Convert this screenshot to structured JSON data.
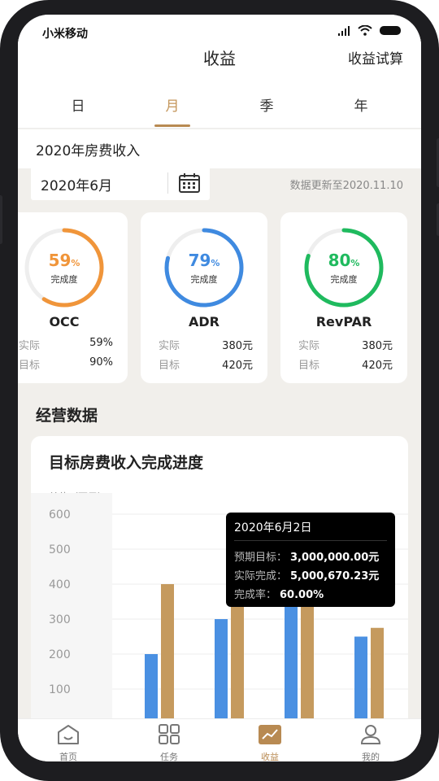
{
  "status_bar": {
    "carrier": "小米移动"
  },
  "header": {
    "title": "收益",
    "trial_link": "收益试算"
  },
  "tabs": [
    {
      "label": "日"
    },
    {
      "label": "月",
      "active": true
    },
    {
      "label": "季"
    },
    {
      "label": "年"
    }
  ],
  "section": {
    "title": "2020年房费收入"
  },
  "date_picker": {
    "value": "2020年6月"
  },
  "update_note": "数据更新至2020.11.10",
  "kpi_cards": [
    {
      "name": "OCC",
      "percent": "59",
      "percent_value": 59,
      "percent_unit": "%",
      "progress_label": "完成度",
      "color": "#f0953a",
      "rows": [
        {
          "key": "实际",
          "value": "59%"
        },
        {
          "key": "目标",
          "value": "90%"
        }
      ]
    },
    {
      "name": "ADR",
      "percent": "79",
      "percent_value": 79,
      "percent_unit": "%",
      "progress_label": "完成度",
      "color": "#3f8ae0",
      "rows": [
        {
          "key": "实际",
          "value": "380元"
        },
        {
          "key": "目标",
          "value": "420元"
        }
      ]
    },
    {
      "name": "RevPAR",
      "percent": "80",
      "percent_value": 80,
      "percent_unit": "%",
      "progress_label": "完成度",
      "color": "#1fba5e",
      "rows": [
        {
          "key": "实际",
          "value": "380元"
        },
        {
          "key": "目标",
          "value": "420元"
        }
      ]
    }
  ],
  "operations": {
    "title": "经营数据"
  },
  "chart_card": {
    "title": "目标房费收入完成进度",
    "unit_label": "单位（万元）"
  },
  "chart_data": {
    "type": "bar",
    "categories": [
      "",
      "",
      "",
      ""
    ],
    "series": [
      {
        "values": [
          200,
          300,
          500,
          250
        ],
        "color": "#4a90e2"
      },
      {
        "values": [
          400,
          500,
          380,
          275
        ],
        "color": "#c59a5e"
      }
    ],
    "y_ticks": [
      "0",
      "100",
      "200",
      "300",
      "400",
      "500",
      "600"
    ],
    "ylim": [
      0,
      600
    ],
    "grid": true
  },
  "tooltip": {
    "date": "2020年6月2日",
    "rows": [
      {
        "key": "预期目标：",
        "value": "3,000,000.00元"
      },
      {
        "key": "实际完成：",
        "value": "5,000,670.23元"
      },
      {
        "key": "完成率：",
        "value": "60.00%"
      }
    ]
  },
  "bottom_nav": [
    {
      "label": "首页",
      "icon": "home-icon"
    },
    {
      "label": "任务",
      "icon": "grid-icon"
    },
    {
      "label": "收益",
      "icon": "chart-icon",
      "active": true
    },
    {
      "label": "我的",
      "icon": "user-icon"
    }
  ],
  "colors": {
    "accent": "#b88a52",
    "occ": "#f0953a",
    "adr": "#3f8ae0",
    "revpar": "#1fba5e"
  }
}
